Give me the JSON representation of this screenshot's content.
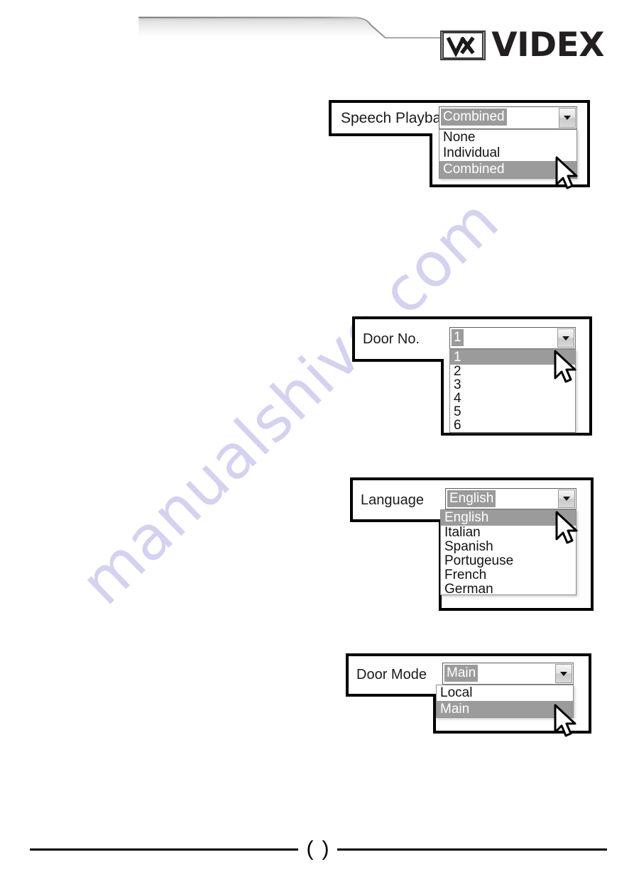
{
  "header": {
    "brand_name": "VIDEX",
    "logo_mark": "vx-monogram",
    "band_color_top": "#b8b8b8",
    "band_color_bottom": "#ffffff"
  },
  "watermark": {
    "text": "manualshive.com",
    "color": "#d4d2ef"
  },
  "callouts": [
    {
      "id": "speech-playback",
      "label": "Speech Playback",
      "selected_value": "Combined",
      "options": [
        "None",
        "Individual",
        "Combined"
      ],
      "cursor_visible": true
    },
    {
      "id": "door-no",
      "label": "Door No.",
      "selected_value": "1",
      "options": [
        "1",
        "2",
        "3",
        "4",
        "5",
        "6"
      ],
      "cursor_visible": true
    },
    {
      "id": "language",
      "label": "Language",
      "selected_value": "English",
      "options": [
        "English",
        "Italian",
        "Spanish",
        "Portugeuse",
        "French",
        "German"
      ],
      "cursor_visible": true
    },
    {
      "id": "door-mode",
      "label": "Door Mode",
      "selected_value": "Main",
      "options": [
        "Local",
        "Main"
      ],
      "cursor_visible": true
    }
  ],
  "footer": {
    "page_number": "",
    "bracket_open": "(",
    "bracket_close": ")"
  },
  "colors": {
    "selection_gray": "#9b9b9b",
    "outline_black": "#000000",
    "text_black": "#1a1a1a"
  }
}
